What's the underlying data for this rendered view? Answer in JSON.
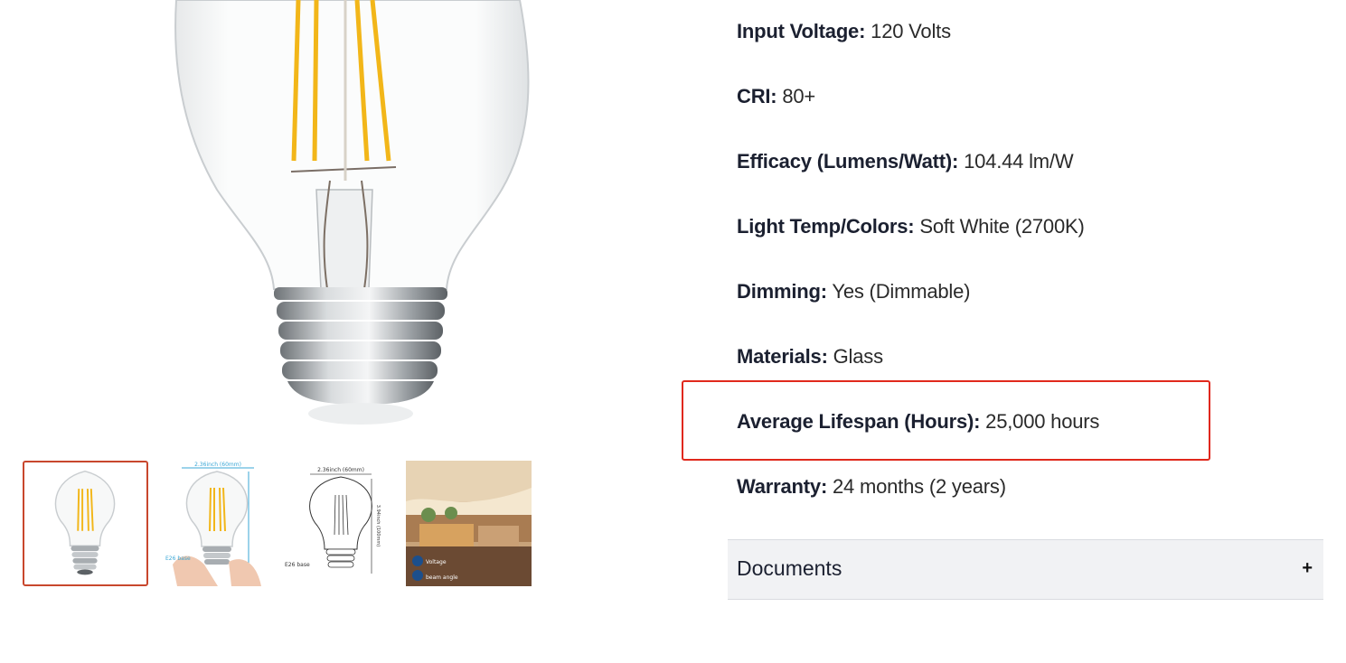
{
  "gallery": {
    "main_image_icon": "filament-bulb-image",
    "thumbnails": [
      {
        "icon": "bulb-photo-thumbnail",
        "active": true
      },
      {
        "icon": "bulb-in-hand-dimensions-thumbnail",
        "active": false,
        "texts": [
          "2.36inch (60mm)",
          "E26 base"
        ]
      },
      {
        "icon": "bulb-line-drawing-thumbnail",
        "active": false,
        "texts": [
          "2.36inch (60mm)",
          "3.94inch (100mm)",
          "E26 base"
        ]
      },
      {
        "icon": "restaurant-interior-thumbnail",
        "active": false,
        "texts": [
          "Voltage",
          "beam angle"
        ]
      }
    ]
  },
  "specs": [
    {
      "key": "Input Voltage:",
      "value": "120 Volts"
    },
    {
      "key": "CRI:",
      "value": "80+"
    },
    {
      "key": "Efficacy (Lumens/Watt):",
      "value": "104.44 lm/W"
    },
    {
      "key": "Light Temp/Colors:",
      "value": "Soft White (2700K)"
    },
    {
      "key": "Dimming:",
      "value": "Yes (Dimmable)"
    },
    {
      "key": "Materials:",
      "value": "Glass"
    },
    {
      "key": "Average Lifespan (Hours):",
      "value": "25,000 hours"
    },
    {
      "key": "Warranty:",
      "value": "24 months (2 years)"
    }
  ],
  "accordion": {
    "title": "Documents",
    "toggle": "+"
  },
  "colors": {
    "highlight": "#e0281c",
    "thumb_active": "#c8472d",
    "filament": "#f2b619"
  }
}
